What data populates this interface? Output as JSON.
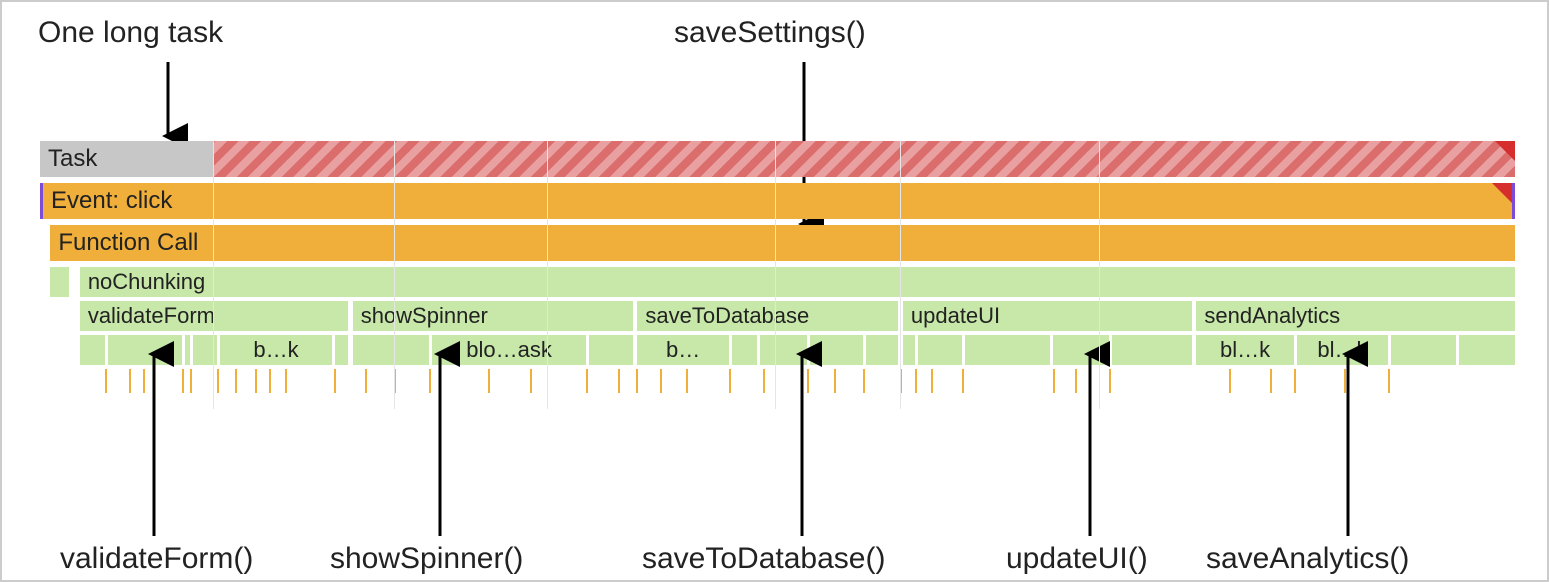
{
  "annotations": {
    "top_left": "One long task",
    "top_right": "saveSettings()",
    "bottom": [
      "validateForm()",
      "showSpinner()",
      "saveToDatabase()",
      "updateUI()",
      "saveAnalytics()"
    ]
  },
  "rows": {
    "task": {
      "label": "Task",
      "hashed_start_pct": 11.7
    },
    "event": {
      "label": "Event: click"
    },
    "function_call": {
      "label": "Function Call",
      "left_pct": 0.7
    },
    "no_chunking": {
      "label": "noChunking",
      "left_pct": 2.7,
      "pre_bar_left_pct": 0.7,
      "pre_bar_width_pct": 1.3
    },
    "functions": [
      {
        "label": "validateForm",
        "left_pct": 2.7,
        "width_pct": 18.2
      },
      {
        "label": "showSpinner",
        "left_pct": 21.2,
        "width_pct": 19.0
      },
      {
        "label": "saveToDatabase",
        "left_pct": 40.5,
        "width_pct": 17.7
      },
      {
        "label": "updateUI",
        "left_pct": 58.5,
        "width_pct": 19.6
      },
      {
        "label": "sendAnalytics",
        "left_pct": 78.4,
        "width_pct": 21.6
      }
    ],
    "blocks": [
      {
        "label": "",
        "left_pct": 2.7,
        "width_pct": 1.7
      },
      {
        "label": "",
        "left_pct": 4.6,
        "width_pct": 5.0
      },
      {
        "label": "",
        "left_pct": 9.8,
        "width_pct": 0.4
      },
      {
        "label": "",
        "left_pct": 10.4,
        "width_pct": 1.6
      },
      {
        "label": "b…k",
        "left_pct": 12.2,
        "width_pct": 7.6
      },
      {
        "label": "",
        "left_pct": 20.0,
        "width_pct": 0.9
      },
      {
        "label": "",
        "left_pct": 21.2,
        "width_pct": 5.2
      },
      {
        "label": "blo…ask",
        "left_pct": 26.6,
        "width_pct": 10.4
      },
      {
        "label": "",
        "left_pct": 37.2,
        "width_pct": 3.0
      },
      {
        "label": "b…",
        "left_pct": 40.5,
        "width_pct": 6.2
      },
      {
        "label": "",
        "left_pct": 46.9,
        "width_pct": 1.7
      },
      {
        "label": "",
        "left_pct": 48.8,
        "width_pct": 3.2
      },
      {
        "label": "",
        "left_pct": 52.2,
        "width_pct": 3.6
      },
      {
        "label": "",
        "left_pct": 56.0,
        "width_pct": 2.2
      },
      {
        "label": "",
        "left_pct": 58.5,
        "width_pct": 0.8
      },
      {
        "label": "",
        "left_pct": 59.5,
        "width_pct": 3.0
      },
      {
        "label": "",
        "left_pct": 62.7,
        "width_pct": 5.8
      },
      {
        "label": "",
        "left_pct": 68.7,
        "width_pct": 3.8
      },
      {
        "label": "",
        "left_pct": 72.7,
        "width_pct": 5.4
      },
      {
        "label": "bl…k",
        "left_pct": 78.4,
        "width_pct": 6.6
      },
      {
        "label": "bl…k",
        "left_pct": 85.2,
        "width_pct": 6.2
      },
      {
        "label": "",
        "left_pct": 91.6,
        "width_pct": 4.4
      },
      {
        "label": "",
        "left_pct": 96.2,
        "width_pct": 3.8
      }
    ],
    "ticks_pct": [
      4.4,
      6.0,
      7.0,
      9.6,
      10.2,
      12.0,
      13.2,
      14.6,
      15.5,
      16.6,
      19.9,
      22.0,
      24.0,
      26.4,
      30.4,
      33.2,
      37.0,
      39.2,
      40.4,
      42.0,
      43.8,
      46.7,
      49.0,
      52.0,
      53.8,
      55.8,
      58.3,
      59.3,
      60.4,
      62.5,
      68.7,
      70.2,
      72.5,
      80.6,
      83.4,
      85.0,
      88.4,
      91.4
    ]
  },
  "vlines_pct": [
    11.7,
    24.0,
    34.4,
    49.8,
    58.3,
    71.8
  ]
}
